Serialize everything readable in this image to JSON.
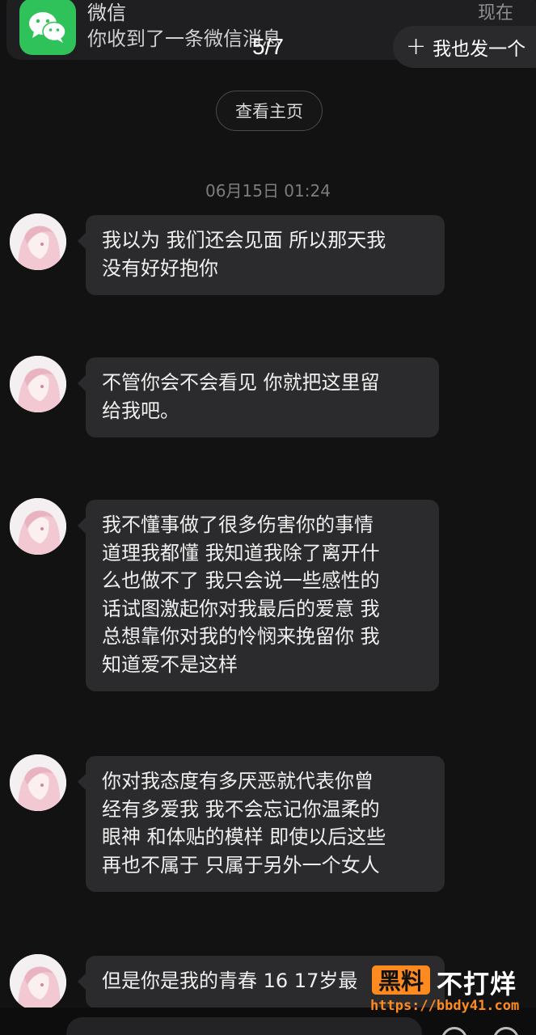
{
  "notification": {
    "app_name": "微信",
    "text": "你收到了一条微信消息",
    "time": "现在",
    "icon": "wechat-icon"
  },
  "story_counter": "5/7",
  "follow_button": {
    "plus": "+",
    "label": "我也发一个"
  },
  "profile_button": "查看主页",
  "timestamp": "06月15日 01:24",
  "messages": [
    {
      "lines": [
        "我以为 我们还会见面 所以那天我",
        "没有好好抱你"
      ]
    },
    {
      "lines": [
        "不管你会不会看见 你就把这里留",
        "给我吧。"
      ]
    },
    {
      "lines": [
        "我不懂事做了很多伤害你的事情",
        "道理我都懂 我知道我除了离开什",
        "么也做不了 我只会说一些感性的",
        "话试图激起你对我最后的爱意 我",
        "总想靠你对我的怜悯来挽留你 我",
        "知道爱不是这样"
      ]
    },
    {
      "lines": [
        "你对我态度有多厌恶就代表你曾",
        "经有多爱我 我不会忘记你温柔的",
        "眼神 和体贴的模样 即使以后这些",
        "再也不属于 只属于另外一个女人"
      ]
    },
    {
      "lines": [
        "但是你是我的青春 16 17岁最"
      ]
    }
  ],
  "watermark": {
    "box": "黑料",
    "big": "不打烊",
    "url": "https://bbdy41.com"
  },
  "colors": {
    "accent": "#2fc25b",
    "bubble": "#2b2b2d",
    "background": "#121212",
    "watermark": "#ff8a1f"
  }
}
